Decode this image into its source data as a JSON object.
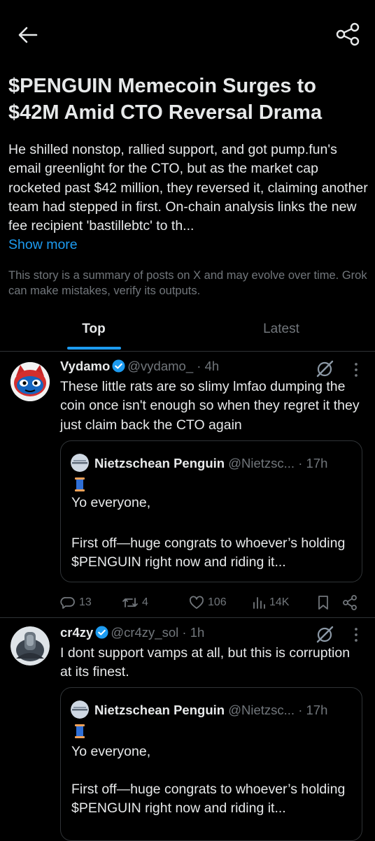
{
  "header": {
    "back_icon": "arrow-left-icon",
    "share_icon": "share-icon"
  },
  "story": {
    "title": "$PENGUIN Memecoin Surges to $42M Amid CTO Reversal Drama",
    "summary": "He shilled nonstop, rallied support, and got pump.fun's email greenlight for the CTO, but as the market cap rocketed past $42 million, they reversed it, claiming another team had stepped in first. On-chain analysis links the new fee recipient 'bastillebtc' to th...",
    "show_more": "Show more",
    "disclaimer": "This story is a summary of posts on X and may evolve over time. Grok can make mistakes, verify its outputs."
  },
  "tabs": [
    {
      "label": "Top",
      "selected": true
    },
    {
      "label": "Latest",
      "selected": false
    }
  ],
  "posts": [
    {
      "name": "Vydamo",
      "handle": "@vydamo_",
      "time": "· 4h",
      "text": "These little rats are so slimy lmfao dumping the coin once isn't enough so when they regret it they just claim back the CTO again",
      "quote": {
        "name": "Nietzschean Penguin",
        "handle": "@Nietzsc...",
        "time": "· 17h",
        "line1": "Yo everyone,",
        "line2": "First off—huge congrats to whoever’s holding $PENGUIN right now and riding it..."
      },
      "stats": {
        "replies": "13",
        "reposts": "4",
        "likes": "106",
        "views": "14K"
      }
    },
    {
      "name": "cr4zy",
      "handle": "@cr4zy_sol",
      "time": "· 1h",
      "text": "I dont support vamps at all, but this is corruption at its finest.",
      "quote": {
        "name": "Nietzschean Penguin",
        "handle": "@Nietzsc...",
        "time": "· 17h",
        "line1": "Yo everyone,",
        "line2": "First off—huge congrats to whoever’s holding $PENGUIN right now and riding it..."
      }
    }
  ],
  "colors": {
    "accent": "#1d9bf0",
    "muted": "#71767b",
    "text": "#e7e9ea",
    "border": "#2f3336"
  }
}
